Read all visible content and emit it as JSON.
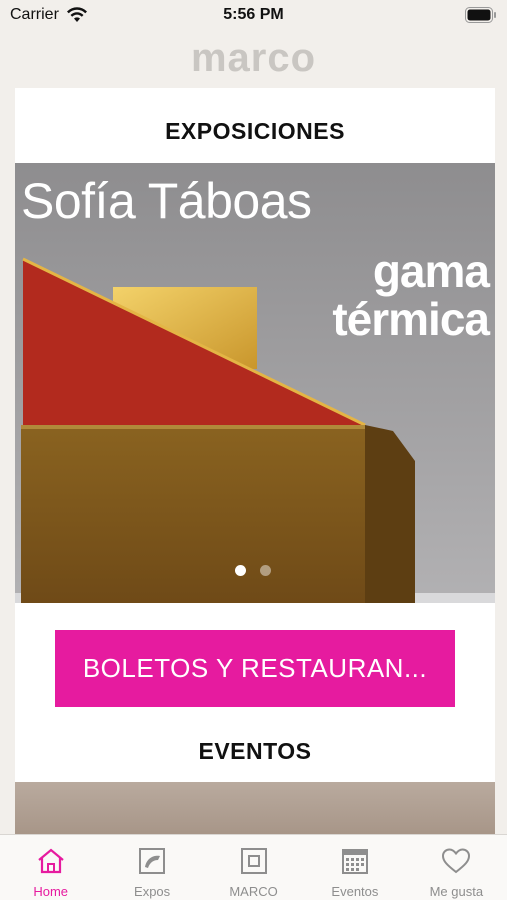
{
  "status_bar": {
    "carrier": "Carrier",
    "time": "5:56 PM"
  },
  "header": {
    "logo": "marco"
  },
  "exhibitions": {
    "title": "EXPOSICIONES",
    "hero": {
      "artist": "Sofía Táboas",
      "show_line1": "gama",
      "show_line2": "térmica"
    }
  },
  "tickets_button": {
    "label": "BOLETOS Y RESTAURAN..."
  },
  "events": {
    "title": "EVENTOS"
  },
  "tabs": [
    {
      "label": "Home",
      "icon": "home-icon",
      "active": true
    },
    {
      "label": "Expos",
      "icon": "expos-icon"
    },
    {
      "label": "MARCO",
      "icon": "marco-icon"
    },
    {
      "label": "Eventos",
      "icon": "calendar-icon"
    },
    {
      "label": "Me gusta",
      "icon": "heart-icon"
    }
  ],
  "colors": {
    "accent": "#e61b9f",
    "background": "#f2efeb",
    "tab_inactive": "#8e8e8e"
  }
}
